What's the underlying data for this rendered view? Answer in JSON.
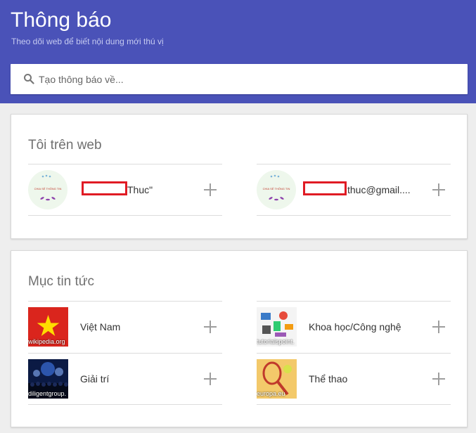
{
  "header": {
    "title": "Thông báo",
    "subtitle": "Theo dõi web để biết nội dung mới thú vị"
  },
  "search": {
    "placeholder": "Tạo thông báo về..."
  },
  "me_on_web": {
    "title": "Tôi trên web",
    "items": [
      {
        "label": "Thuc\"",
        "logo_text": "CHIA SẺ THÔNG TIN"
      },
      {
        "label": "thuc@gmail....",
        "logo_text": "CHIA SẺ THÔNG TIN"
      }
    ]
  },
  "news": {
    "title": "Mục tin tức",
    "items": [
      {
        "label": "Việt Nam",
        "source": "wikipedia.org"
      },
      {
        "label": "Khoa học/Công nghệ",
        "source": "tutorialspoint."
      },
      {
        "label": "Giải trí",
        "source": "diligentgroup."
      },
      {
        "label": "Thể thao",
        "source": "europa.eu"
      }
    ]
  },
  "colors": {
    "header_bg": "#4a52b8",
    "redaction": "#e01b24"
  },
  "icons": [
    "search-icon",
    "plus-icon"
  ]
}
